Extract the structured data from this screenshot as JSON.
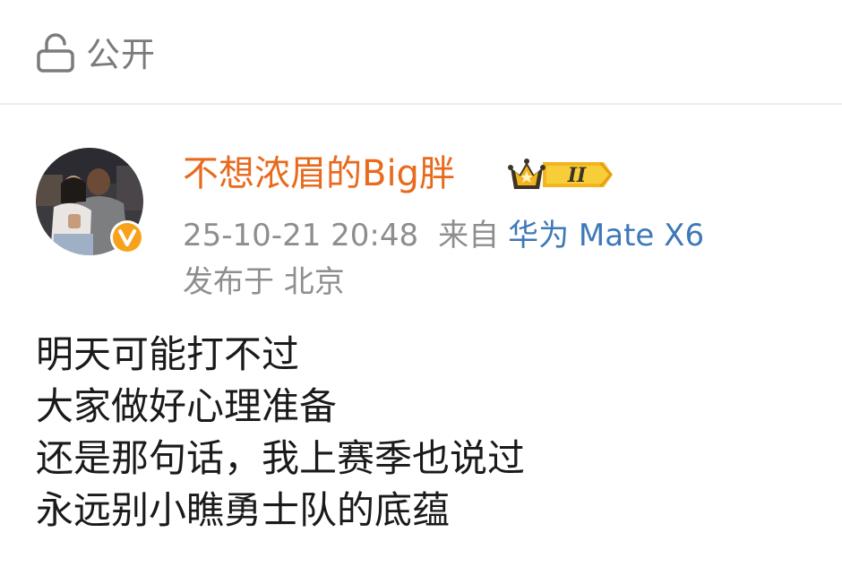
{
  "visibility": {
    "icon": "lock-open-icon",
    "label": "公开"
  },
  "post": {
    "author": {
      "name": "不想浓眉的Big胖",
      "verified_icon": "verified-v-icon",
      "vip_badge": {
        "icon": "crown-icon",
        "level_text": "II"
      },
      "avatar": "avatar-photo"
    },
    "timestamp": "25-10-21 20:48",
    "source_label": "来自",
    "source_device": "华为 Mate X6",
    "location": "发布于 北京",
    "body_lines": [
      "明天可能打不过",
      "大家做好心理准备",
      "还是那句话，我上赛季也说过",
      "永远别小瞧勇士队的底蕴"
    ]
  },
  "colors": {
    "username": "#e86a1c",
    "meta": "#8e8e8e",
    "link": "#3d78b7",
    "verified": "#f7a21b",
    "vip_gold": "#f3b51f"
  }
}
